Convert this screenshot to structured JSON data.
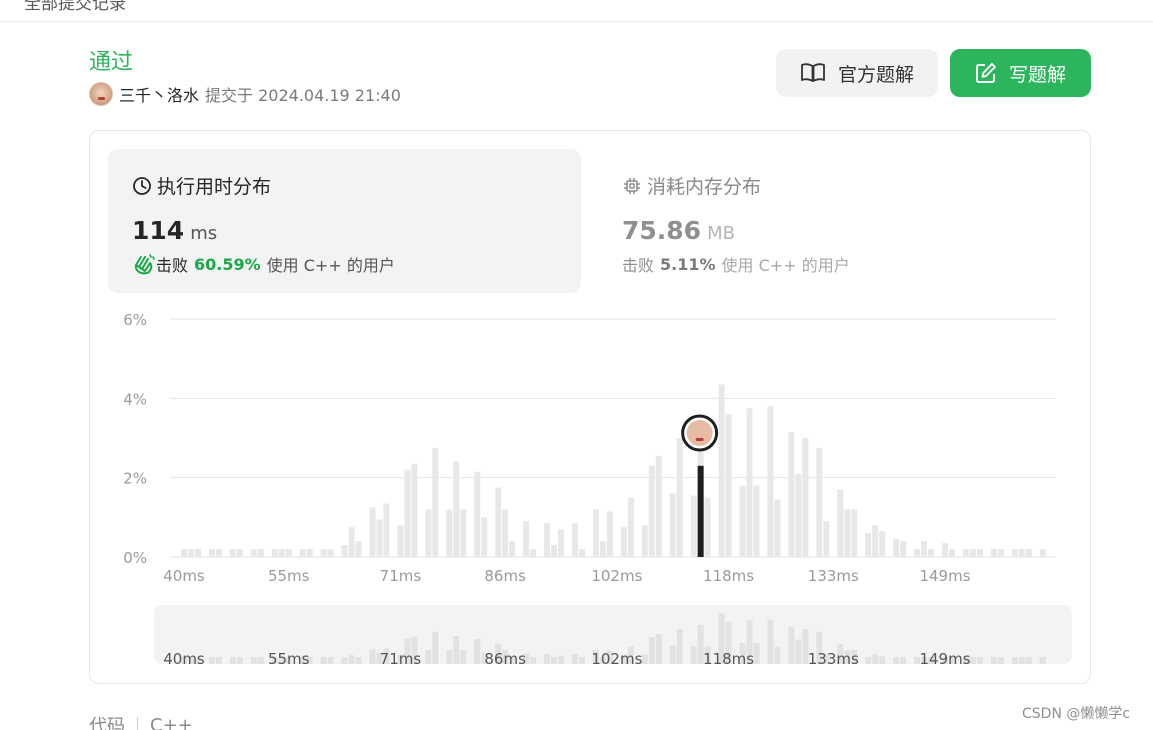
{
  "header": {
    "breadcrumb": "全部提交记录"
  },
  "submission": {
    "status": "通过",
    "user": "三千丶洛水",
    "submitted_label": "提交于 2024.04.19 21:40"
  },
  "buttons": {
    "official_solution": "官方题解",
    "write_solution": "写题解"
  },
  "runtime": {
    "title": "执行用时分布",
    "value": "114",
    "unit": "ms",
    "beat_label": "击败",
    "percent": "60.59%",
    "suffix": "使用 C++ 的用户"
  },
  "memory": {
    "title": "消耗内存分布",
    "value": "75.86",
    "unit": "MB",
    "beat_label": "击败",
    "percent": "5.11%",
    "suffix": "使用 C++ 的用户"
  },
  "colors": {
    "accent": "#2db55d",
    "bar": "#e8e8e8",
    "marker": "#1f1f1f"
  },
  "chart_data": {
    "type": "bar",
    "title": "",
    "xlabel": "",
    "ylabel": "",
    "ylim": [
      0,
      6
    ],
    "yticks": [
      "0%",
      "2%",
      "4%",
      "6%"
    ],
    "xtick_labels": [
      "40ms",
      "55ms",
      "71ms",
      "86ms",
      "102ms",
      "118ms",
      "133ms",
      "149ms"
    ],
    "xtick_values": [
      40,
      55,
      71,
      86,
      102,
      118,
      133,
      149
    ],
    "x_range": [
      38,
      164
    ],
    "marker": {
      "x": 114,
      "value": 2.3
    },
    "x": [
      40,
      41,
      42,
      44,
      45,
      47,
      48,
      50,
      51,
      53,
      54,
      55,
      57,
      58,
      60,
      61,
      63,
      64,
      65,
      67,
      68,
      69,
      71,
      72,
      73,
      75,
      76,
      78,
      79,
      80,
      82,
      83,
      85,
      86,
      87,
      89,
      90,
      92,
      93,
      94,
      96,
      97,
      99,
      100,
      101,
      103,
      104,
      106,
      107,
      108,
      110,
      111,
      113,
      114,
      115,
      117,
      118,
      120,
      121,
      122,
      124,
      125,
      127,
      128,
      129,
      131,
      132,
      134,
      135,
      136,
      138,
      139,
      140,
      142,
      143,
      145,
      146,
      147,
      149,
      150,
      152,
      153,
      154,
      156,
      157,
      159,
      160,
      161,
      163
    ],
    "values": [
      0.2,
      0.2,
      0.2,
      0.2,
      0.2,
      0.2,
      0.2,
      0.2,
      0.2,
      0.2,
      0.2,
      0.2,
      0.2,
      0.2,
      0.2,
      0.2,
      0.3,
      0.75,
      0.4,
      1.25,
      0.95,
      1.35,
      0.8,
      2.2,
      2.35,
      1.2,
      2.75,
      1.2,
      2.4,
      1.2,
      2.15,
      1.0,
      1.75,
      1.2,
      0.4,
      0.9,
      0.2,
      0.85,
      0.3,
      0.7,
      0.85,
      0.2,
      1.2,
      0.4,
      1.15,
      0.75,
      1.5,
      0.8,
      2.3,
      2.55,
      1.6,
      3.0,
      1.55,
      3.35,
      1.5,
      4.35,
      3.6,
      1.8,
      3.75,
      1.8,
      3.8,
      1.45,
      3.15,
      2.1,
      3.0,
      2.75,
      0.9,
      1.7,
      1.2,
      1.2,
      0.6,
      0.8,
      0.65,
      0.45,
      0.4,
      0.2,
      0.4,
      0.2,
      0.35,
      0.2,
      0.2,
      0.2,
      0.2,
      0.2,
      0.2,
      0.2,
      0.2,
      0.2,
      0.2
    ]
  },
  "footer": {
    "tab_code": "代码",
    "tab_lang": "C++"
  },
  "watermark": "CSDN @懒懒学c"
}
